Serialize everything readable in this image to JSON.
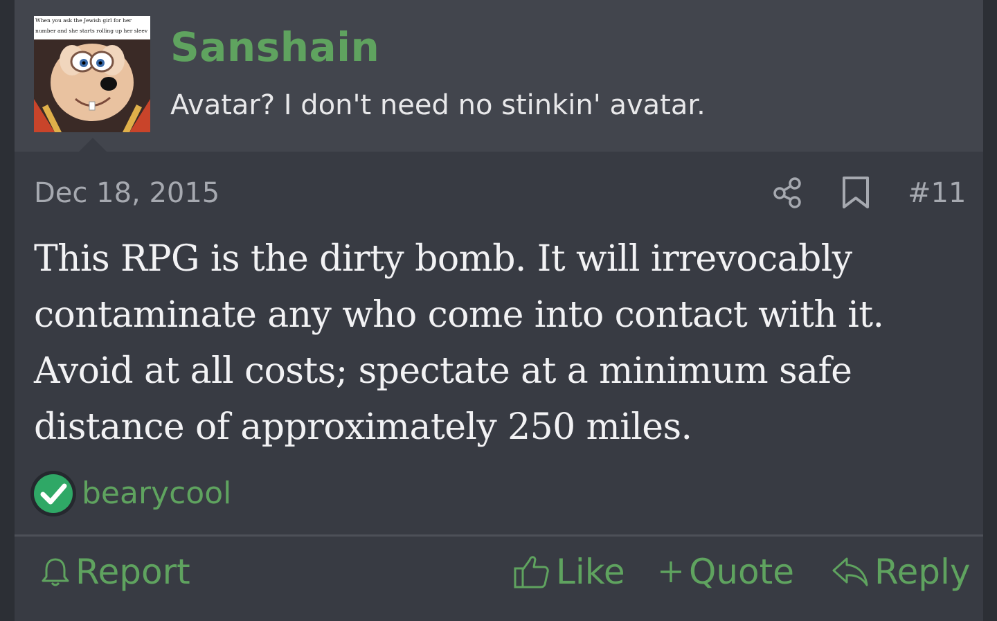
{
  "post": {
    "author": {
      "username": "Sanshain",
      "title": "Avatar? I don't need no stinkin' avatar.",
      "avatar_caption": "When you ask the Jewish girl for her number and she starts rolling up her sleev"
    },
    "date": "Dec 18, 2015",
    "number": "#11",
    "body": "This RPG is the dirty bomb. It will irrevocably contaminate any who come into contact with it. Avoid at all costs; spectate at a minimum safe distance of approximately 250 miles.",
    "reactions": {
      "icon": "checkmark-icon",
      "users": "bearycool"
    },
    "actions": {
      "report": "Report",
      "like": "Like",
      "quote": "Quote",
      "reply": "Reply"
    }
  },
  "colors": {
    "accent": "#5fa35f",
    "reaction": "#2fa866",
    "background": "#383b43",
    "header": "#42454d"
  }
}
